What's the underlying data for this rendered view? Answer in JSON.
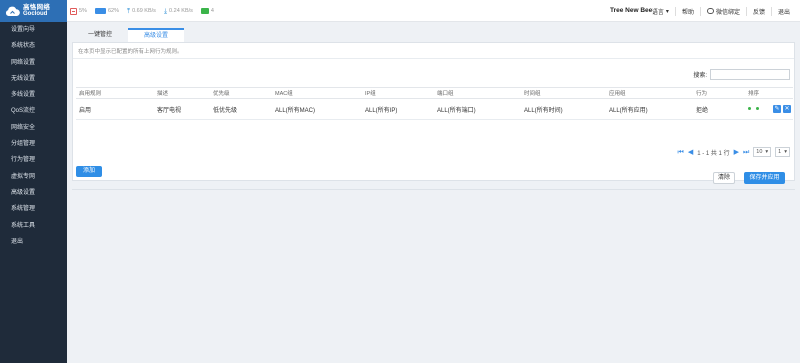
{
  "brand": {
    "name_cn": "高恪网络",
    "name_en": "Gocloud"
  },
  "stats": {
    "cpu": "5%",
    "mem": "62%",
    "up": "0.69 KB/s",
    "down": "0.24 KB/s",
    "clients": "4"
  },
  "device": {
    "name": "Tree New Bee"
  },
  "topmenu": {
    "language": "语言",
    "help": "帮助",
    "wechat": "微信绑定",
    "feedback": "反馈",
    "logout": "退出"
  },
  "sidebar": {
    "items": [
      {
        "label": "设置向导"
      },
      {
        "label": "系统状态"
      },
      {
        "label": "网络设置"
      },
      {
        "label": "无线设置"
      },
      {
        "label": "多线设置"
      },
      {
        "label": "QoS流控"
      },
      {
        "label": "网络安全"
      },
      {
        "label": "分组管理"
      },
      {
        "label": "行为管理"
      },
      {
        "label": "虚拟专网"
      },
      {
        "label": "高级设置"
      },
      {
        "label": "系统管理"
      },
      {
        "label": "系统工具"
      },
      {
        "label": "退出"
      }
    ]
  },
  "tabs": [
    {
      "label": "一键管控"
    },
    {
      "label": "高级设置"
    }
  ],
  "panel": {
    "description": "在本页中显示已配置的所有上网行为规则。"
  },
  "search": {
    "label": "搜索:",
    "value": ""
  },
  "table": {
    "headers": [
      "启用规则",
      "描述",
      "优先级",
      "MAC组",
      "IP组",
      "端口组",
      "时间组",
      "应用组",
      "行为",
      "排序",
      ""
    ],
    "rows": [
      {
        "enable": "启用",
        "desc": "客厅电视",
        "priority": "低优先级",
        "mac": "ALL(所有MAC)",
        "ip": "ALL(所有IP)",
        "port": "ALL(所有端口)",
        "time": "ALL(所有时间)",
        "app": "ALL(所有应用)",
        "action": "拒绝"
      }
    ]
  },
  "pager": {
    "info": "1 - 1 共 1 行",
    "page_size": "10",
    "page": "1"
  },
  "buttons": {
    "add": "添加",
    "clear": "清除",
    "save": "保存并应用"
  },
  "colors": {
    "sidebar": "#1f2b3a",
    "accent": "#2f8ee6",
    "logo_bg": "#2d6fb5"
  }
}
